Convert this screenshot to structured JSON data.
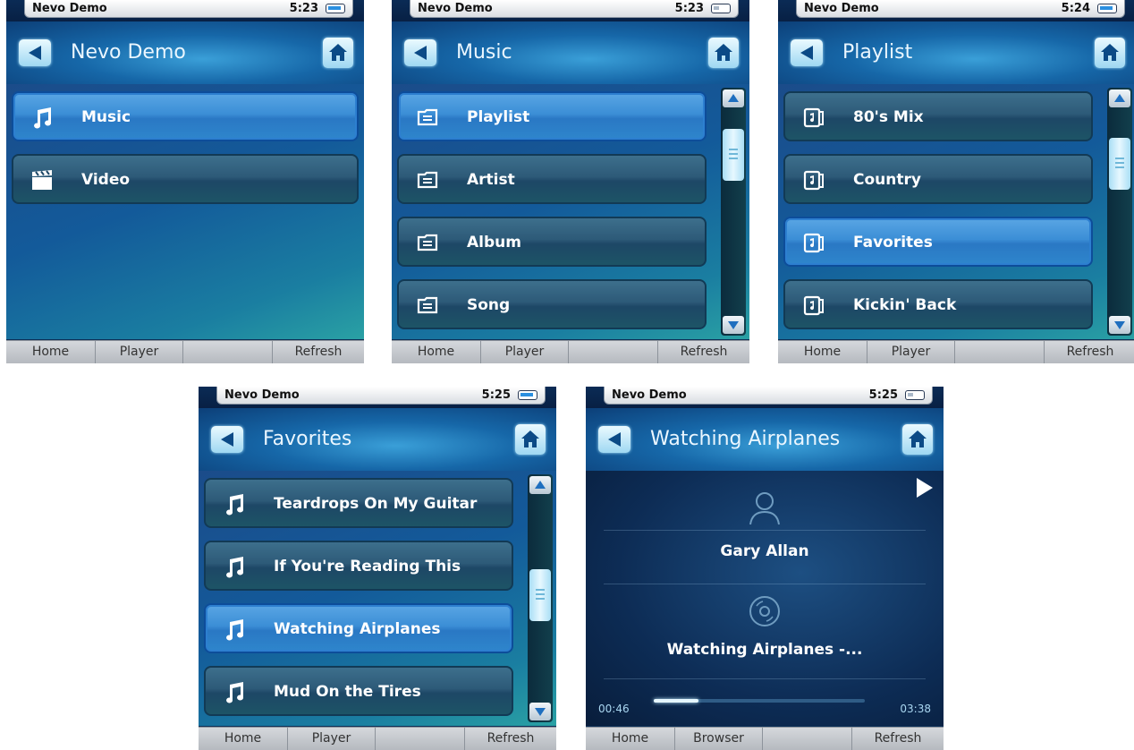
{
  "status": {
    "title": "Nevo Demo"
  },
  "screens": [
    {
      "time": "5:23",
      "header_title": "Nevo Demo",
      "items": [
        {
          "label": "Music",
          "icon": "music-note-icon",
          "selected": true
        },
        {
          "label": "Video",
          "icon": "clapperboard-icon",
          "selected": false
        }
      ],
      "footer": [
        "Home",
        "Player",
        "",
        "Refresh"
      ]
    },
    {
      "time": "5:23",
      "header_title": "Music",
      "items": [
        {
          "label": "Playlist",
          "icon": "folder-icon",
          "selected": true
        },
        {
          "label": "Artist",
          "icon": "folder-icon",
          "selected": false
        },
        {
          "label": "Album",
          "icon": "folder-icon",
          "selected": false
        },
        {
          "label": "Song",
          "icon": "folder-icon",
          "selected": false
        }
      ],
      "footer": [
        "Home",
        "Player",
        "",
        "Refresh"
      ]
    },
    {
      "time": "5:24",
      "header_title": "Playlist",
      "items": [
        {
          "label": "80's Mix",
          "icon": "playlist-icon",
          "selected": false
        },
        {
          "label": "Country",
          "icon": "playlist-icon",
          "selected": false
        },
        {
          "label": "Favorites",
          "icon": "playlist-icon",
          "selected": true
        },
        {
          "label": "Kickin' Back",
          "icon": "playlist-icon",
          "selected": false
        }
      ],
      "footer": [
        "Home",
        "Player",
        "",
        "Refresh"
      ]
    },
    {
      "time": "5:25",
      "header_title": "Favorites",
      "items": [
        {
          "label": "Teardrops On My Guitar",
          "icon": "music-note-icon",
          "selected": false
        },
        {
          "label": "If You're Reading This",
          "icon": "music-note-icon",
          "selected": false
        },
        {
          "label": "Watching Airplanes",
          "icon": "music-note-icon",
          "selected": true
        },
        {
          "label": "Mud On the Tires",
          "icon": "music-note-icon",
          "selected": false
        }
      ],
      "footer": [
        "Home",
        "Player",
        "",
        "Refresh"
      ]
    },
    {
      "time": "5:25",
      "header_title": "Watching Airplanes",
      "player": {
        "artist": "Gary Allan",
        "song": "Watching Airplanes -...",
        "elapsed": "00:46",
        "total": "03:38",
        "progress": 0.21
      },
      "footer": [
        "Home",
        "Browser",
        "",
        "Refresh"
      ]
    }
  ],
  "colors": {
    "header": "#1667a8",
    "selected_item": "#3b8ed6",
    "item": "#2d5a78",
    "footer": "#c5c9ce"
  }
}
